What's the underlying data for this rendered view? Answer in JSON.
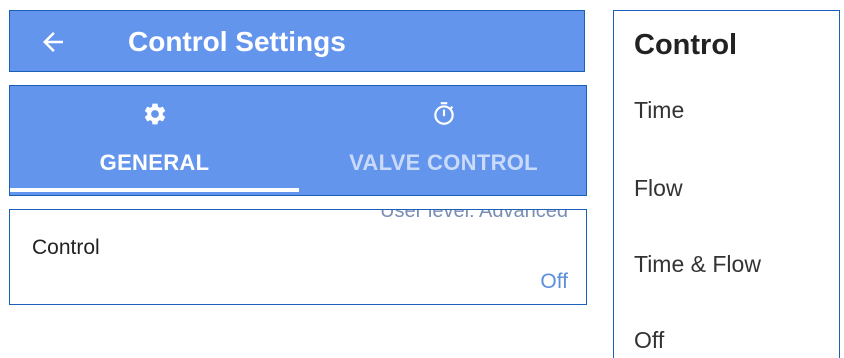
{
  "header": {
    "title": "Control Settings",
    "back_icon": "arrow-left-icon"
  },
  "tabs": [
    {
      "label": "GENERAL",
      "icon": "gear-icon",
      "active": true
    },
    {
      "label": "VALVE CONTROL",
      "icon": "stopwatch-icon",
      "active": false
    }
  ],
  "setting": {
    "user_level_text": "User level: Advanced",
    "label": "Control",
    "value": "Off"
  },
  "menu": {
    "title": "Control",
    "items": [
      "Time",
      "Flow",
      "Time & Flow",
      "Off"
    ]
  },
  "colors": {
    "primary": "#6495ed",
    "border": "#1a5fb8",
    "value_text": "#5b8fdc"
  }
}
